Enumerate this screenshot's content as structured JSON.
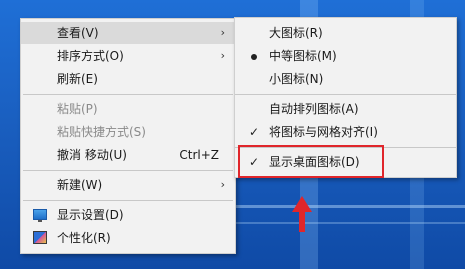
{
  "context_menu": {
    "items": [
      {
        "label": "查看(V)",
        "arrow": "›"
      },
      {
        "label": "排序方式(O)",
        "arrow": "›"
      },
      {
        "label": "刷新(E)"
      },
      {
        "label": "粘贴(P)"
      },
      {
        "label": "粘贴快捷方式(S)"
      },
      {
        "label": "撤消 移动(U)",
        "shortcut": "Ctrl+Z"
      },
      {
        "label": "新建(W)",
        "arrow": "›"
      },
      {
        "label": "显示设置(D)",
        "icon": "display-settings-icon"
      },
      {
        "label": "个性化(R)",
        "icon": "personalize-icon"
      }
    ]
  },
  "view_submenu": {
    "items": [
      {
        "label": "大图标(R)"
      },
      {
        "label": "中等图标(M)",
        "mark": "bullet"
      },
      {
        "label": "小图标(N)"
      },
      {
        "label": "自动排列图标(A)"
      },
      {
        "label": "将图标与网格对齐(I)",
        "mark": "check"
      },
      {
        "label": "显示桌面图标(D)",
        "mark": "check"
      }
    ],
    "check_glyph": "✓"
  },
  "annotation": {
    "box_color": "#e0262b",
    "arrow_color": "#e0262b"
  }
}
